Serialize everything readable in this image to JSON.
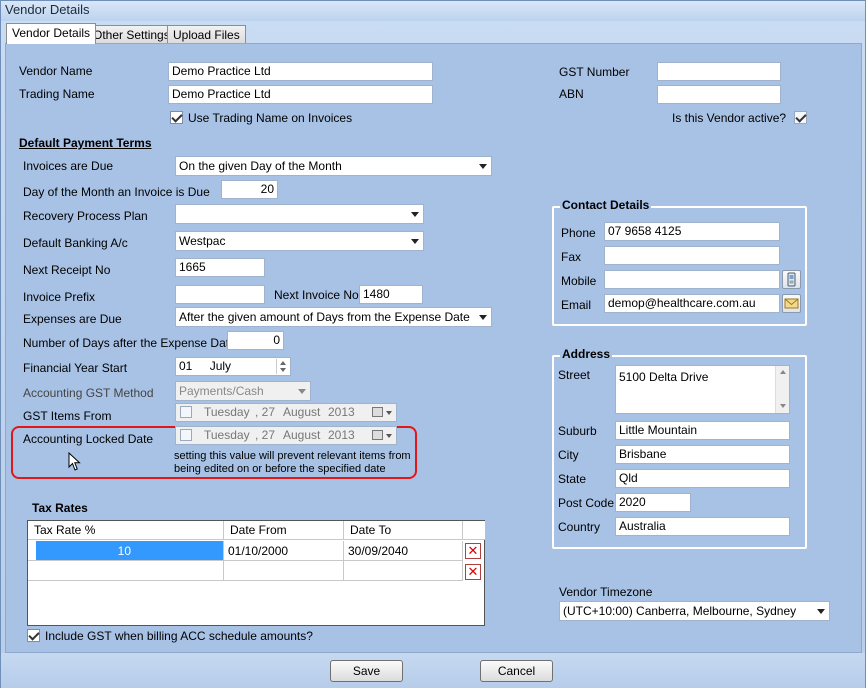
{
  "window": {
    "title": "Vendor Details"
  },
  "tabs": [
    {
      "label": "Vendor Details",
      "active": true
    },
    {
      "label": "Other Settings",
      "active": false
    },
    {
      "label": "Upload Files",
      "active": false
    }
  ],
  "vendor": {
    "vendor_name_label": "Vendor Name",
    "vendor_name_value": "Demo Practice Ltd",
    "trading_name_label": "Trading Name",
    "trading_name_value": "Demo Practice Ltd",
    "use_trading_name_label": "Use Trading Name on Invoices",
    "gst_number_label": "GST Number",
    "gst_number_value": "",
    "abn_label": "ABN",
    "abn_value": "",
    "active_label": "Is this Vendor active?"
  },
  "payment_terms": {
    "heading": "Default Payment Terms",
    "invoices_due_label": "Invoices are Due",
    "invoices_due_value": "On the given Day of the Month",
    "day_of_month_label": "Day of the Month an Invoice is Due",
    "day_of_month_value": "20",
    "recovery_plan_label": "Recovery Process Plan",
    "recovery_plan_value": "",
    "banking_label": "Default Banking A/c",
    "banking_value": "Westpac",
    "next_receipt_label": "Next Receipt No",
    "next_receipt_value": "1665",
    "invoice_prefix_label": "Invoice Prefix",
    "invoice_prefix_value": "",
    "next_invoice_label": "Next Invoice No",
    "next_invoice_value": "1480",
    "expenses_due_label": "Expenses are Due",
    "expenses_due_value": "After the given amount of Days from the Expense Date",
    "days_after_label": "Number of Days after the Expense Date",
    "days_after_value": "0",
    "fy_start_label": "Financial Year Start",
    "fy_start_day": "01",
    "fy_start_month": "July",
    "gst_method_label": "Accounting GST Method",
    "gst_method_value": "Payments/Cash",
    "gst_items_from_label": "GST Items From",
    "gst_items_from_weekday": "Tuesday",
    "gst_items_from_day": ", 27",
    "gst_items_from_month": "August",
    "gst_items_from_year": "2013",
    "locked_date_label": "Accounting Locked Date",
    "locked_date_weekday": "Tuesday",
    "locked_date_day": ", 27",
    "locked_date_month": "August",
    "locked_date_year": "2013",
    "locked_note_line1": "setting this value will prevent relevant items from",
    "locked_note_line2": "being edited on or before the specified date"
  },
  "tax_rates": {
    "heading": "Tax Rates",
    "columns": [
      "Tax Rate %",
      "Date From",
      "Date To"
    ],
    "rows": [
      {
        "rate": "10",
        "from": "01/10/2000",
        "to": "30/09/2040"
      },
      {
        "rate": "",
        "from": "",
        "to": ""
      }
    ],
    "delete_glyph": "✕",
    "include_gst_label": "Include GST when billing ACC schedule amounts?"
  },
  "contact": {
    "heading": "Contact Details",
    "phone_label": "Phone",
    "phone_value": "07 9658 4125",
    "fax_label": "Fax",
    "fax_value": "",
    "mobile_label": "Mobile",
    "mobile_value": "",
    "email_label": "Email",
    "email_value": "demop@healthcare.com.au"
  },
  "address": {
    "heading": "Address",
    "street_label": "Street",
    "street_value": "5100 Delta Drive",
    "suburb_label": "Suburb",
    "suburb_value": "Little Mountain",
    "city_label": "City",
    "city_value": "Brisbane",
    "state_label": "State",
    "state_value": "Qld",
    "postcode_label": "Post Code",
    "postcode_value": "2020",
    "country_label": "Country",
    "country_value": "Australia"
  },
  "timezone": {
    "label": "Vendor Timezone",
    "value": "(UTC+10:00) Canberra, Melbourne, Sydney"
  },
  "footer": {
    "save_label": "Save",
    "cancel_label": "Cancel"
  },
  "colors": {
    "highlight": "#e01818",
    "selected_row": "#3399ff",
    "panel": "#a8c2e6"
  }
}
